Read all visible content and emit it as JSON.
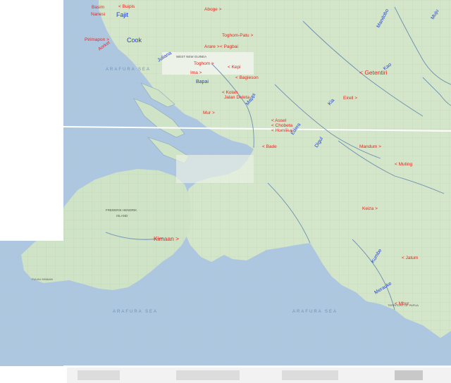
{
  "colors": {
    "sea": "#aec7e0",
    "land": "#d4e6c9",
    "coast_land": "#cfe3c6",
    "grid": "#9fb4c8",
    "river": "#6f8fb0",
    "city_label": "#e8251f",
    "river_label": "#1f3fd8"
  },
  "labels": {
    "basim": "Basim",
    "buipis": "< Buipis",
    "nanesi": "Nanesi",
    "fajit": "Fajit",
    "aboge": "Aboge >",
    "toghom_patu": "Toghom-Patu >",
    "pirimapon": "Pirimapon >",
    "aorket": "Aorket",
    "cook": "Cook",
    "juliana": "Juliana",
    "arare": "Arare >",
    "pagbai": "< Pagbai",
    "toghom": "Toghom >",
    "ima": "Ima >",
    "kepi": "< Kepi",
    "bagieson": "< Bagieson",
    "bapai": "Bapai",
    "kolan": "< Kolan",
    "jalan_deleta": "Jalan Deleta",
    "mappi": "Mappi",
    "mur": "Mur >",
    "getentiri": "< Getentiri",
    "kao": "Kao",
    "muju": "Muju",
    "mandobo": "Mandobo",
    "kia": "Kia",
    "eirell": "Eirell >",
    "edera": "Edera",
    "assel": "< Assel",
    "chobeta": "< Chobeta",
    "homlikai": "< Homlikai",
    "digul": "Digul",
    "bade": "< Bade",
    "mandum": "Mandum >",
    "muting": "< Muting",
    "keiza": "Keiza >",
    "kimaan": "Kimaan >",
    "kumbe": "Kumbe",
    "jatum": "< Jatum",
    "merauke": "Merauke",
    "mbur": "< Mbur"
  },
  "sea_labels": {
    "north": "ARAFURA SEA",
    "west": "ARAFURA SEA",
    "south": "ARAFURA SEA"
  },
  "map_labels": {
    "frederik_hendrik": "FREDERIK HENDRIK",
    "island": "ISLAND",
    "pulau_kimaan": "PULAU KIMAAN",
    "west_new_guinea": "WEST NEW GUINEA",
    "territory": "TERRITORY OF PAPUA"
  }
}
